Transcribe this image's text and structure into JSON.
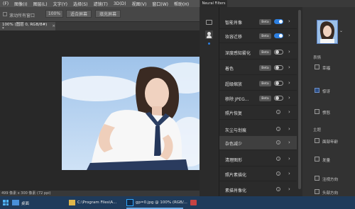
{
  "menubar": {
    "items": [
      "(F)",
      "图像(I)",
      "图层(L)",
      "文字(Y)",
      "选择(S)",
      "滤镜(T)",
      "3D(D)",
      "视图(V)",
      "窗口(W)",
      "帮助(H)"
    ]
  },
  "options": {
    "scroll_all": "滚动所有窗口",
    "zoom": "100%",
    "fit_screen": "适合屏幕",
    "fill_screen": "填充屏幕"
  },
  "document": {
    "tab_title": "100% (图层 0, RGB/8#) *",
    "status": "499 像素 x 300 像素 (72 ppi)"
  },
  "neural_filters": {
    "tab_label": "Neural Filters",
    "items": [
      {
        "label": "智能肖像",
        "beta": "Beta",
        "control": "toggle-on"
      },
      {
        "label": "妆容迁移",
        "beta": "Beta",
        "control": "toggle-on"
      },
      {
        "label": "深度感知雾化",
        "beta": "Beta",
        "control": "toggle-off"
      },
      {
        "label": "着色",
        "beta": "Beta",
        "control": "toggle-off"
      },
      {
        "label": "超级缩放",
        "beta": "Beta",
        "control": "toggle-off"
      },
      {
        "label": "移除 JPEG...",
        "beta": "Beta",
        "control": "toggle-off"
      },
      {
        "label": "照片恢复",
        "beta": "",
        "control": "info"
      },
      {
        "label": "灰尘与划痕",
        "beta": "",
        "control": "info"
      },
      {
        "label": "杂色减少",
        "beta": "",
        "control": "info"
      },
      {
        "label": "清理图形",
        "beta": "",
        "control": "info"
      },
      {
        "label": "照片素描化",
        "beta": "",
        "control": "info"
      },
      {
        "label": "素描肖像化",
        "beta": "",
        "control": "info"
      }
    ],
    "selected_index": 8,
    "settings": {
      "section_expression": "表情",
      "happy": "幸福",
      "surprise": "惊讶",
      "anger": "愤怒",
      "section_theme": "主题",
      "facial_age": "面部年龄",
      "hair_thickness": "发量",
      "eye_direction": "注视方向",
      "head_direction": "头部方向"
    }
  },
  "taskbar": {
    "start": "桌面",
    "explorer_item": "C:\\Program Files\\A...",
    "ps_item": "gp=0.jpg @ 100% (RGB/..."
  },
  "colors": {
    "accent": "#2d7fe0",
    "panel": "#2b2b2b",
    "taskbar": "#1f3b5b"
  }
}
